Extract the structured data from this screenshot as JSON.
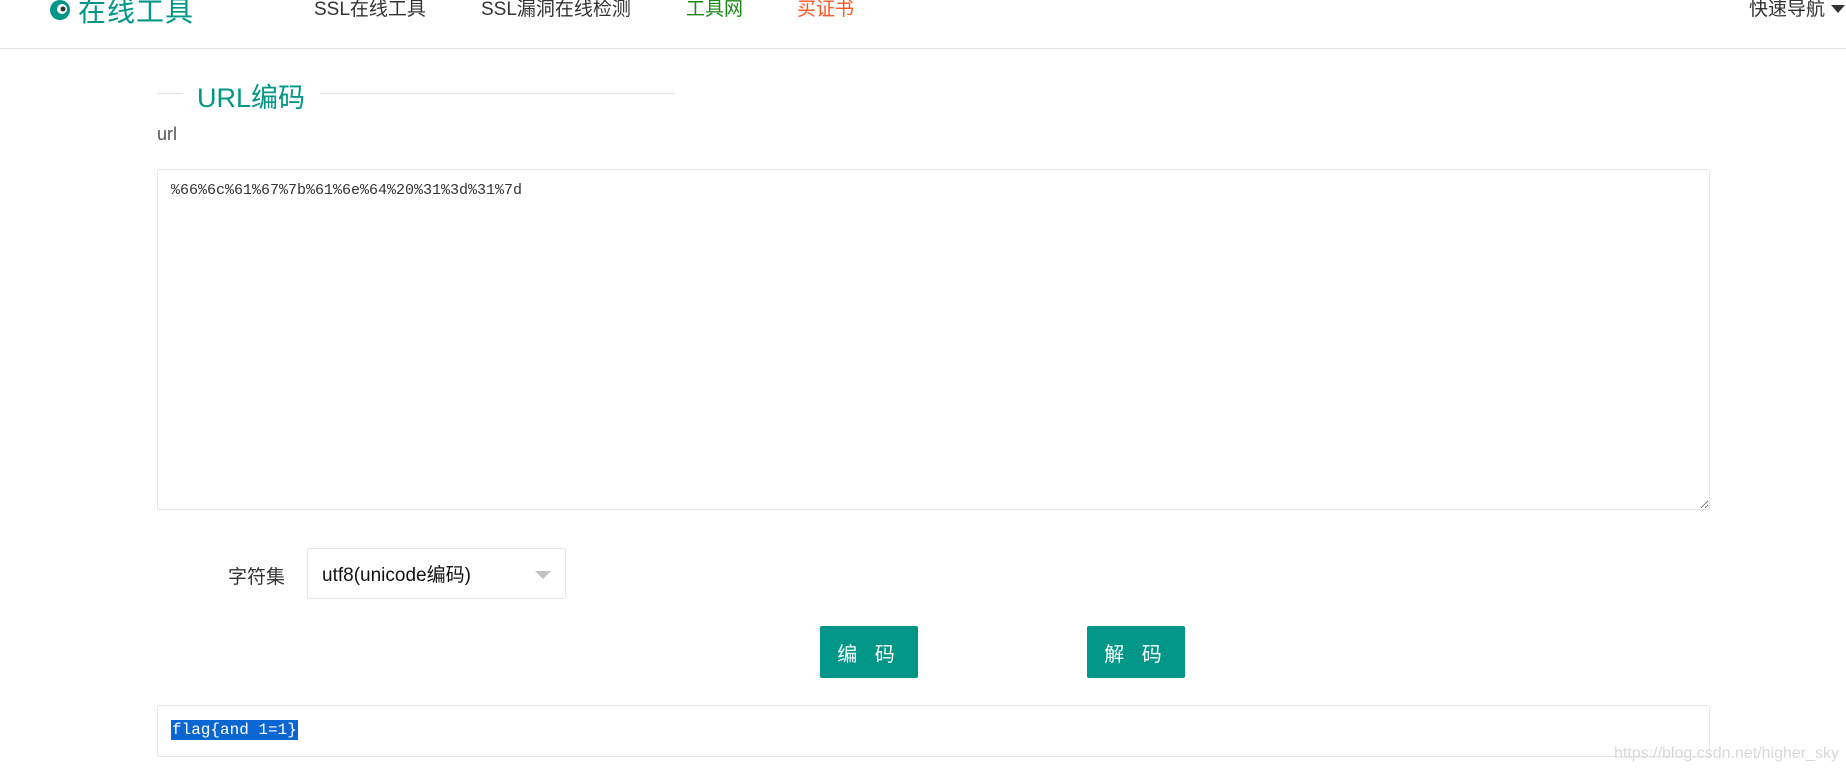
{
  "header": {
    "logo_text": "在线工具",
    "logo_icon": "eye-logo-icon",
    "nav": [
      {
        "label": "SSL在线工具",
        "color": "#333333"
      },
      {
        "label": "SSL漏洞在线检测",
        "color": "#333333"
      },
      {
        "label": "工具网",
        "color": "#1a8a1a"
      },
      {
        "label": "买证书",
        "color": "#ff5722"
      }
    ],
    "quick_nav_label": "快速导航",
    "quick_nav_icon": "caret-down-icon"
  },
  "section": {
    "title": "URL编码",
    "url_label": "url"
  },
  "input": {
    "value": "%66%6c%61%67%7b%61%6e%64%20%31%3d%31%7d"
  },
  "charset": {
    "label": "字符集",
    "selected": "utf8(unicode编码)"
  },
  "buttons": {
    "encode_label": "编 码",
    "decode_label": "解 码"
  },
  "output": {
    "value": "flag{and 1=1}"
  },
  "watermark": "https://blog.csdn.net/higher_sky",
  "colors": {
    "accent": "#009688",
    "selection": "#0a66d2"
  }
}
